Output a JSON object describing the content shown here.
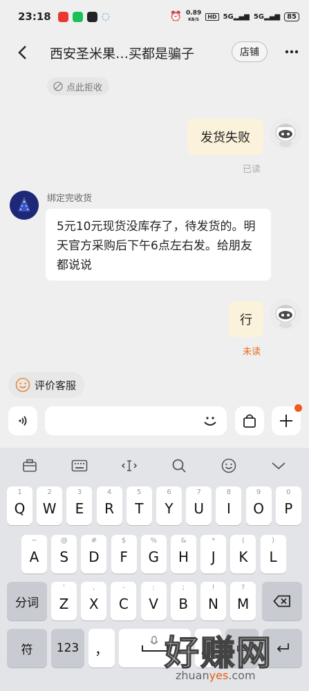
{
  "status_bar": {
    "time": "23:18",
    "net_speed": "0.89",
    "net_unit": "KB/S",
    "hd": "HD",
    "signal1": "5G",
    "signal2": "5G",
    "battery": "85"
  },
  "nav": {
    "title": "西安圣米果…买都是骗子",
    "shop_label": "店铺"
  },
  "reject_label": "点此拒收",
  "messages": [
    {
      "text": "发货失败",
      "status": "已读"
    },
    {
      "sender": "绑定完收货",
      "text": "5元10元现货没库存了，待发货的。明天官方采购后下午6点左右发。给朋友都说说"
    },
    {
      "text": "行",
      "status": "未读"
    }
  ],
  "rate_label": "评价客服",
  "keyboard": {
    "row1": [
      [
        "1",
        "Q"
      ],
      [
        "2",
        "W"
      ],
      [
        "3",
        "E"
      ],
      [
        "4",
        "R"
      ],
      [
        "5",
        "T"
      ],
      [
        "6",
        "Y"
      ],
      [
        "7",
        "U"
      ],
      [
        "8",
        "I"
      ],
      [
        "9",
        "O"
      ],
      [
        "0",
        "P"
      ]
    ],
    "row2": [
      [
        "~",
        "A"
      ],
      [
        "@",
        "S"
      ],
      [
        "#",
        "D"
      ],
      [
        "$",
        "F"
      ],
      [
        "%",
        "G"
      ],
      [
        "&",
        "H"
      ],
      [
        "*",
        "J"
      ],
      [
        "(",
        "K"
      ],
      [
        ")",
        "L"
      ]
    ],
    "row3": [
      [
        "'",
        "Z"
      ],
      [
        ",",
        "X"
      ],
      [
        "-",
        "C"
      ],
      [
        ":",
        "V"
      ],
      [
        ";",
        "B"
      ],
      [
        "!",
        "N"
      ],
      [
        "?",
        "M"
      ]
    ],
    "fenci": "分词",
    "fu": "符",
    "num": "123",
    "comma": "，",
    "space": "⎵",
    "zhong": "中"
  },
  "watermark": {
    "text": "好赚网",
    "url_prefix": "zhuan",
    "url_highlight": "yes",
    "url_suffix": ".com"
  },
  "colors": {
    "self_bubble": "#fbf2dc",
    "unread": "#e86b1c",
    "badge": "#f05a1a"
  }
}
